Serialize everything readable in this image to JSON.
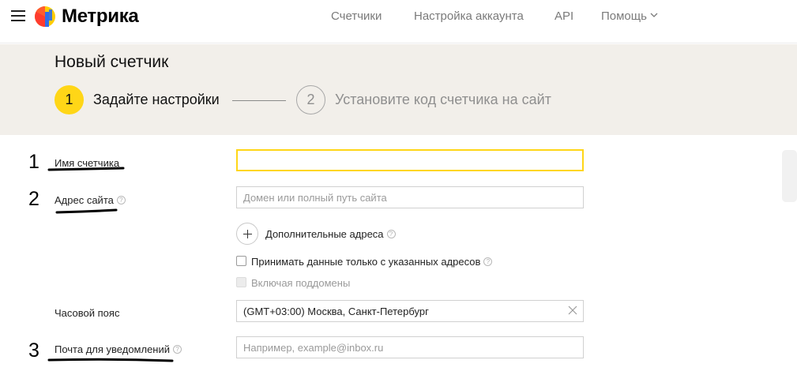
{
  "header": {
    "brand": "Метрика",
    "nav": [
      {
        "label": "Счетчики"
      },
      {
        "label": "Настройка аккаунта"
      },
      {
        "label": "API"
      },
      {
        "label": "Помощь"
      }
    ]
  },
  "wizard": {
    "title": "Новый счетчик",
    "steps": [
      {
        "number": "1",
        "label": "Задайте настройки",
        "active": true
      },
      {
        "number": "2",
        "label": "Установите код счетчика на сайт",
        "active": false
      }
    ]
  },
  "annotations": [
    "1",
    "2",
    "3"
  ],
  "form": {
    "counter_name": {
      "label": "Имя счетчика",
      "value": ""
    },
    "site_address": {
      "label": "Адрес сайта",
      "placeholder": "Домен или полный путь сайта"
    },
    "additional_addresses_label": "Дополнительные адреса",
    "only_listed_label": "Принимать данные только с указанных адресов",
    "subdomains_label": "Включая поддомены",
    "timezone": {
      "label": "Часовой пояс",
      "value": "(GMT+03:00) Москва, Санкт-Петербург"
    },
    "notify_email": {
      "label": "Почта для уведомлений",
      "placeholder": "Например, example@inbox.ru"
    }
  },
  "colors": {
    "accent": "#ffd617",
    "steps_bg": "#f2efea"
  }
}
